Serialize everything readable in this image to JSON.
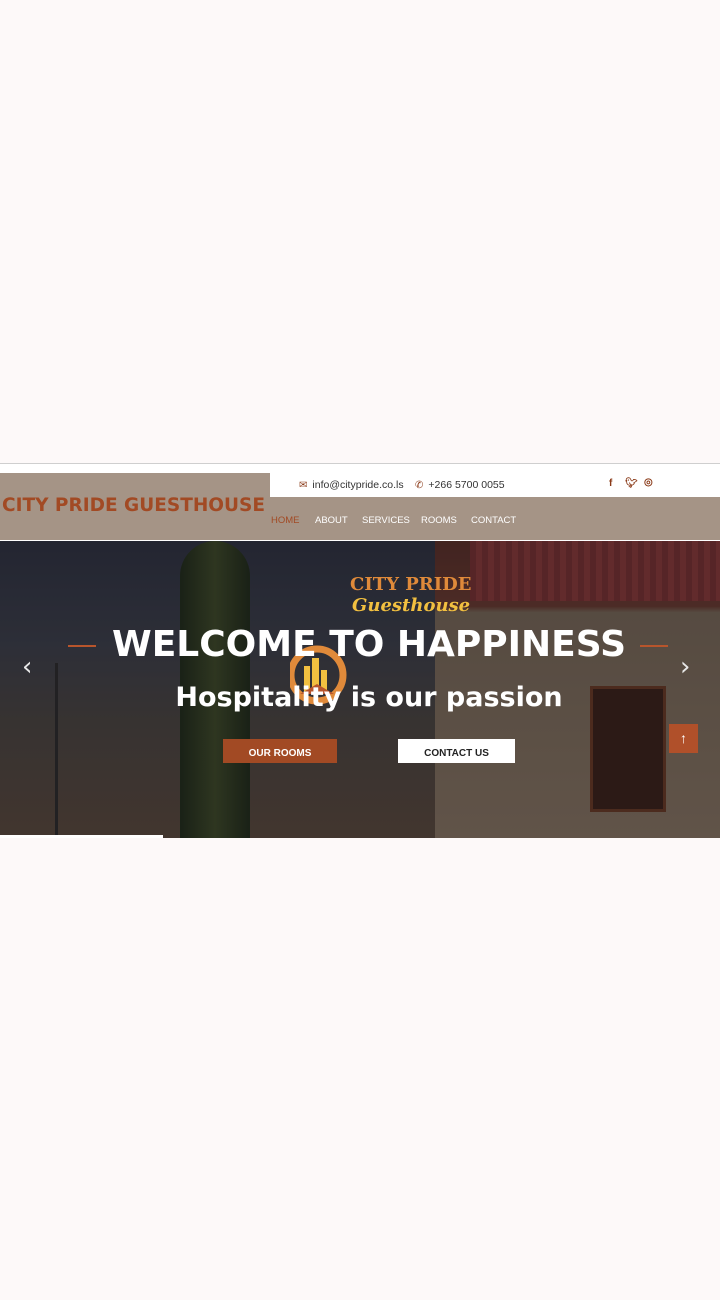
{
  "brand": {
    "name": "CITY PRIDE GUESTHOUSE"
  },
  "contact": {
    "email": "info@citypride.co.ls",
    "phone": "+266 5700 0055",
    "email_icon": "envelope-icon",
    "phone_icon": "phone-icon"
  },
  "social": {
    "facebook": "f",
    "twitter": "t",
    "instagram": "instagram"
  },
  "nav": {
    "items": [
      {
        "label": "HOME",
        "active": true
      },
      {
        "label": "ABOUT"
      },
      {
        "label": "SERVICES"
      },
      {
        "label": "ROOMS"
      },
      {
        "label": "CONTACT"
      }
    ]
  },
  "hero": {
    "logo_line1": "CITY PRIDE",
    "logo_line2": "Guesthouse",
    "headline": "WELCOME TO HAPPINESS",
    "subheadline": "Hospitality is our passion",
    "primary_button": "OUR ROOMS",
    "secondary_button": "CONTACT US",
    "prev_arrow": "‹",
    "next_arrow": "›",
    "to_top": "↑"
  },
  "colors": {
    "brand": "#a24a24",
    "bar": "#a59486",
    "background": "#fdf9f9"
  }
}
